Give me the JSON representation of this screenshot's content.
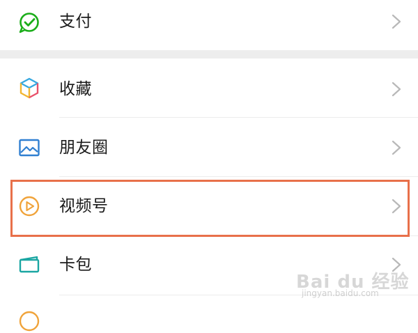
{
  "menu": {
    "items": [
      {
        "label": "支付",
        "icon": "wechat-pay-icon"
      },
      {
        "label": "收藏",
        "icon": "favorites-cube-icon"
      },
      {
        "label": "朋友圈",
        "icon": "moments-picture-icon"
      },
      {
        "label": "视频号",
        "icon": "channels-play-icon"
      },
      {
        "label": "卡包",
        "icon": "card-wallet-icon"
      },
      {
        "label": "",
        "icon": "emoji-icon"
      }
    ],
    "highlighted_item": "视频号"
  },
  "colors": {
    "pay_green": "#1aad19",
    "channels_orange": "#f0a33a",
    "moments_blue": "#2f7fd1",
    "card_teal": "#1aa6a2",
    "highlight_border": "#e8704a",
    "separator": "#ededed"
  },
  "watermark": {
    "main": "Bai du 经验",
    "sub": "jingyan.baidu.com"
  }
}
